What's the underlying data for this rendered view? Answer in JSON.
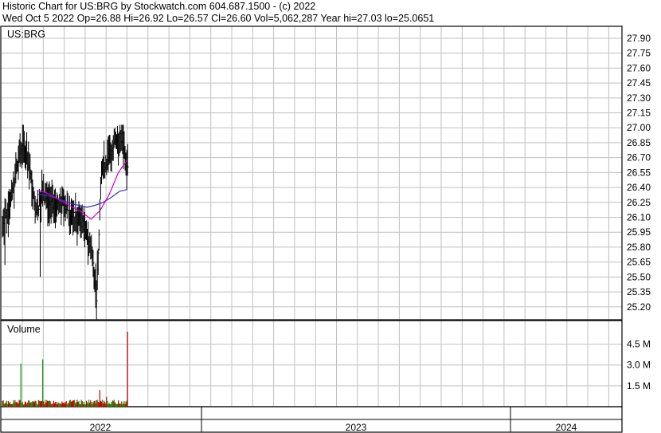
{
  "header": {
    "line1": "Historic Chart for US:BRG by Stockwatch.com 604.687.1500 - (c) 2022",
    "line2": "Wed Oct  5 2022  Op=26.88  Hi=26.92  Lo=26.57  Cl=26.60  Vol=5,062,287  Year hi=27.03  lo=25.0651"
  },
  "colors": {
    "grid": "#c0c0c0",
    "price": "#000000",
    "ma_short": "#cc00cc",
    "ma_long": "#3333cc",
    "vol_up": "#009900",
    "vol_down": "#cc0000"
  },
  "chart_data": [
    {
      "type": "line",
      "title": "US:BRG",
      "ylim": [
        25.07,
        28.02
      ],
      "yticks": [
        "27.90",
        "27.75",
        "27.60",
        "27.45",
        "27.30",
        "27.15",
        "27.00",
        "26.85",
        "26.70",
        "26.55",
        "26.40",
        "26.25",
        "26.10",
        "25.95",
        "25.80",
        "25.65",
        "25.50",
        "25.35",
        "25.20"
      ],
      "ma": [
        {
          "color_key": "ma_long",
          "values": [
            26.33,
            26.32,
            26.3,
            26.27,
            26.24,
            26.22,
            26.2,
            26.22,
            26.25,
            26.3,
            26.36,
            26.38
          ]
        },
        {
          "color_key": "ma_short",
          "values": [
            26.37,
            26.35,
            26.3,
            26.25,
            26.2,
            26.15,
            26.08,
            26.17,
            26.33,
            26.55,
            26.68
          ]
        }
      ]
    },
    {
      "type": "bar",
      "title": "Volume",
      "ylim": [
        0,
        6.2
      ],
      "yticks": [
        "4.5 M",
        "3.0 M",
        "1.5 M"
      ]
    }
  ],
  "x_axis": {
    "labels": [
      "2022",
      "2023",
      "2024"
    ]
  }
}
